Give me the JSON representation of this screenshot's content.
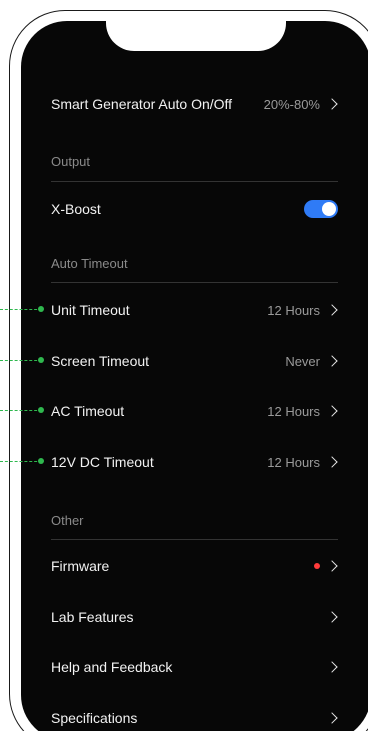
{
  "settings": {
    "smart_generator": {
      "label": "Smart Generator Auto On/Off",
      "value": "20%-80%"
    },
    "output_header": "Output",
    "x_boost": {
      "label": "X-Boost",
      "enabled": true
    },
    "auto_timeout_header": "Auto Timeout",
    "unit_timeout": {
      "label": "Unit Timeout",
      "value": "12 Hours"
    },
    "screen_timeout": {
      "label": "Screen Timeout",
      "value": "Never"
    },
    "ac_timeout": {
      "label": "AC Timeout",
      "value": "12 Hours"
    },
    "dc_timeout": {
      "label": "12V DC Timeout",
      "value": "12 Hours"
    },
    "other_header": "Other",
    "firmware": {
      "label": "Firmware",
      "has_update": true
    },
    "lab_features": {
      "label": "Lab Features"
    },
    "help_feedback": {
      "label": "Help and Feedback"
    },
    "specifications": {
      "label": "Specifications"
    }
  },
  "colors": {
    "screen_bg": "#070707",
    "toggle_on": "#2f7bf6",
    "update_dot": "#ff3b3b",
    "callout": "#2fb84e"
  }
}
